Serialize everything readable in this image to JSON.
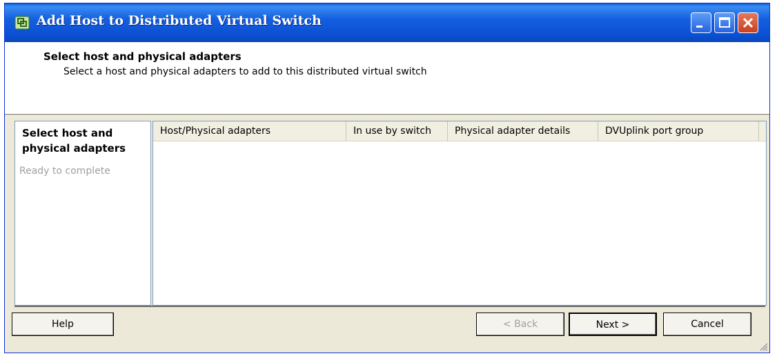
{
  "window": {
    "title": "Add Host to Distributed Virtual Switch"
  },
  "header": {
    "title": "Select host and physical adapters",
    "subtitle": "Select a host and physical adapters to add to this distributed virtual switch"
  },
  "steps": {
    "active": "Select host and physical adapters",
    "next": "Ready to complete"
  },
  "table": {
    "columns": [
      "Host/Physical adapters",
      "In use by switch",
      "Physical adapter details",
      "DVUplink port group"
    ]
  },
  "buttons": {
    "help": "Help",
    "back": "< Back",
    "next": "Next >",
    "cancel": "Cancel"
  },
  "icons": {
    "app": "vsphere-switch-icon",
    "minimize": "minimize-icon",
    "maximize": "maximize-icon",
    "close": "close-icon"
  },
  "colors": {
    "titlebar": "#0a4fd0",
    "close": "#c8401e",
    "dialog": "#ece9d8"
  }
}
